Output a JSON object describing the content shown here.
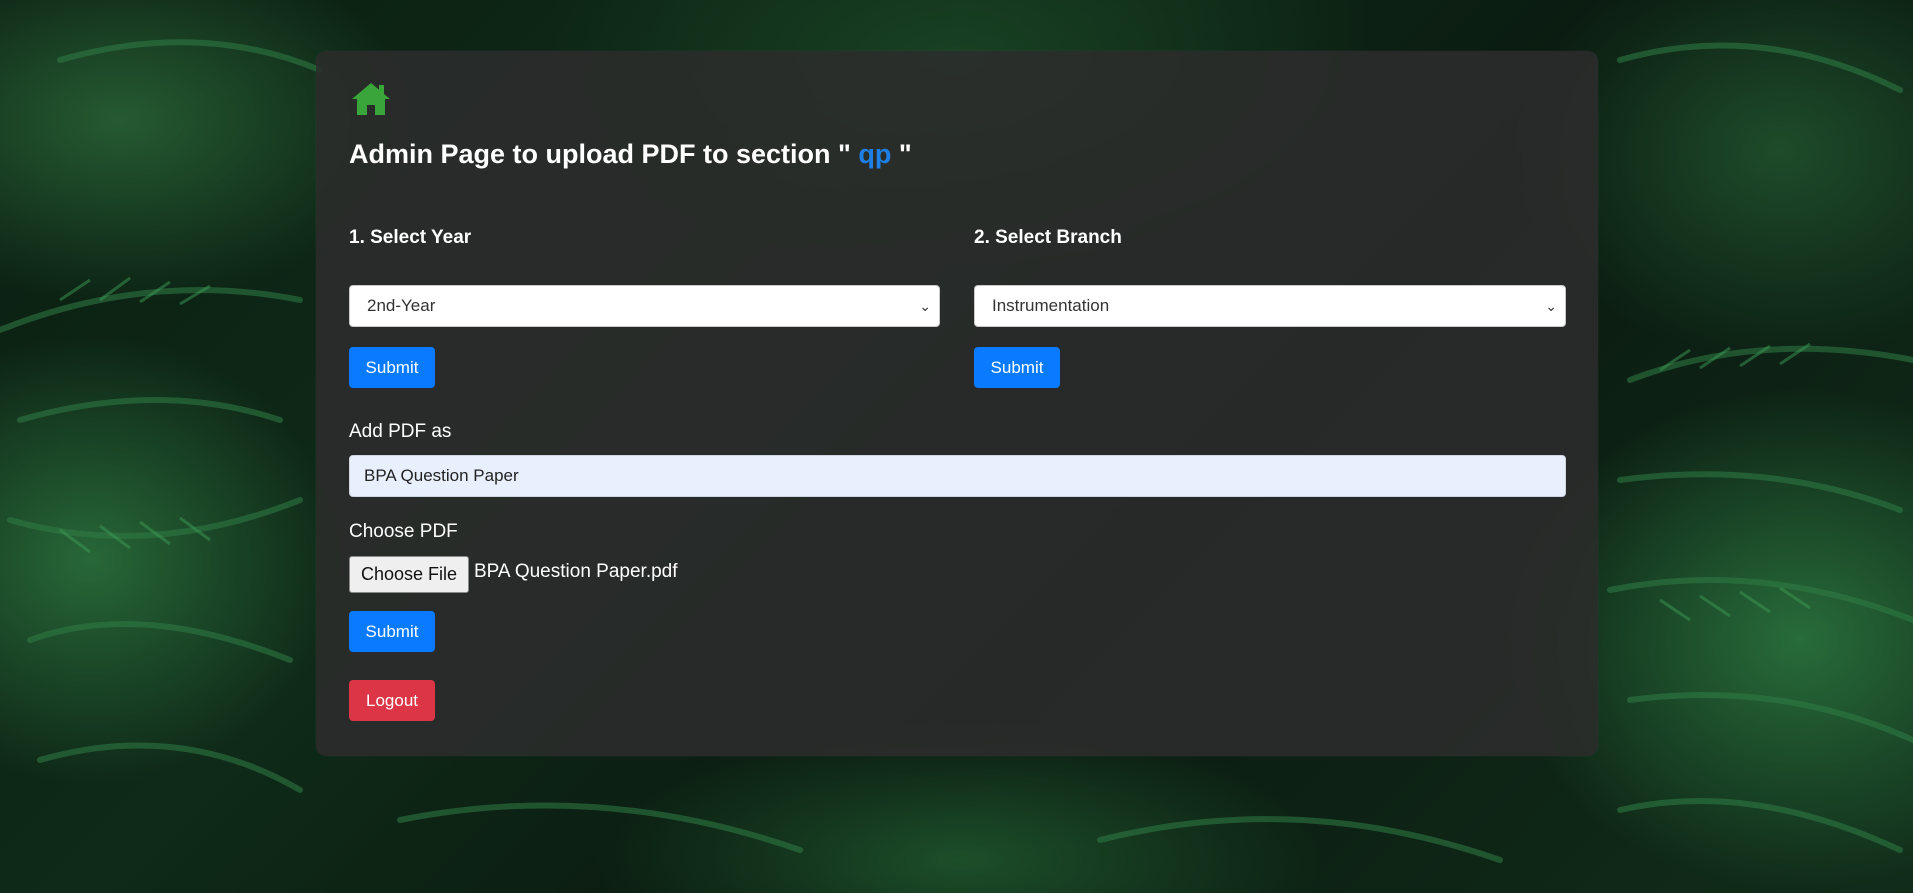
{
  "header": {
    "title_prefix": "Admin Page to upload PDF to section \" ",
    "title_section": "qp",
    "title_suffix": " \""
  },
  "year": {
    "label": "1. Select Year",
    "selected": "2nd-Year",
    "submit_label": "Submit"
  },
  "branch": {
    "label": "2. Select Branch",
    "selected": "Instrumentation",
    "submit_label": "Submit"
  },
  "pdf": {
    "name_label": "Add PDF as",
    "name_value": "BPA Question Paper",
    "choose_label": "Choose PDF",
    "choose_button": "Choose File",
    "file_name": "BPA Question Paper.pdf",
    "submit_label": "Submit"
  },
  "logout_label": "Logout",
  "colors": {
    "accent": "#1e80e6",
    "primary_button": "#0a7bff",
    "danger_button": "#dc3545",
    "home_icon": "#3aa53a"
  },
  "icons": {
    "home": "home-icon"
  }
}
